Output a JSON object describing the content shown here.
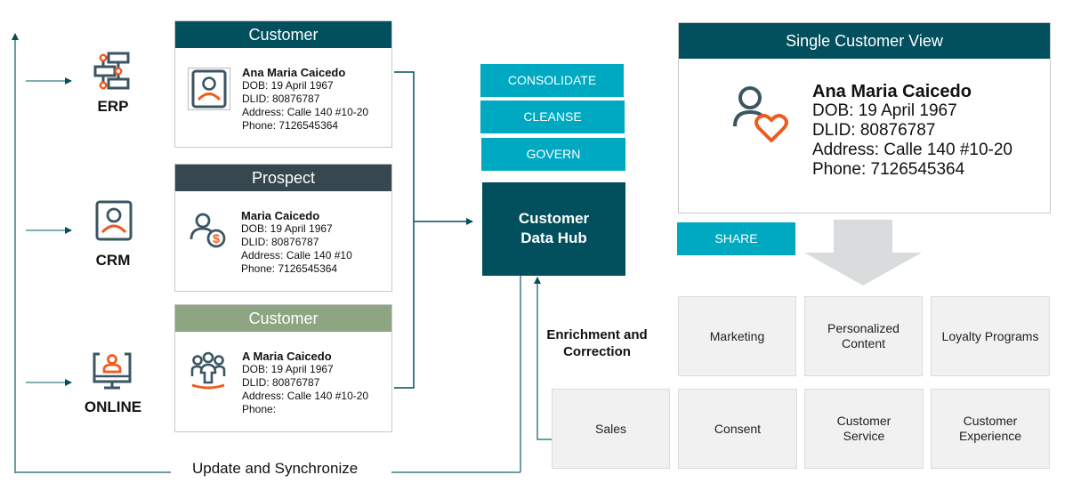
{
  "colors": {
    "dark_teal": "#024f5e",
    "slate": "#37474f",
    "sage": "#8da582",
    "cyan": "#00a9c2",
    "orange": "#f25a1d",
    "tile_gray": "#f1f1f1",
    "arrow_gray": "#d8dcdd"
  },
  "sources": [
    {
      "label": "ERP",
      "icon": "org-chart-icon"
    },
    {
      "label": "CRM",
      "icon": "contact-card-icon"
    },
    {
      "label": "ONLINE",
      "icon": "monitor-user-icon"
    }
  ],
  "records": [
    {
      "header": "Customer",
      "header_color": "#024f5e",
      "icon": "contact-card-icon",
      "name": "Ana Maria Caicedo",
      "dob": "DOB: 19 April 1967",
      "dlid": "DLID: 80876787",
      "address": "Address: Calle 140 #10-20",
      "phone": "Phone: 7126545364"
    },
    {
      "header": "Prospect",
      "header_color": "#37474f",
      "icon": "user-dollar-icon",
      "name": "Maria Caicedo",
      "dob": "DOB: 19 April 1967",
      "dlid": "DLID: 80876787",
      "address": "Address: Calle 140 #10",
      "phone": "Phone: 7126545364"
    },
    {
      "header": "Customer",
      "header_color": "#8da582",
      "icon": "user-group-icon",
      "name": "A Maria Caicedo",
      "dob": "DOB: 19 April 1967",
      "dlid": "DLID: 80876787",
      "address": "Address: Calle 140 #10-20",
      "phone": "Phone:"
    }
  ],
  "processes": [
    "CONSOLIDATE",
    "CLEANSE",
    "GOVERN"
  ],
  "hub": {
    "line1": "Customer",
    "line2": "Data Hub"
  },
  "single_view": {
    "title": "Single Customer View",
    "icon": "user-heart-icon",
    "name": "Ana Maria Caicedo",
    "dob": "DOB: 19 April 1967",
    "dlid": "DLID: 80876787",
    "address": "Address: Calle 140 #10-20",
    "phone": "Phone: 7126545364"
  },
  "share_label": "SHARE",
  "enrichment": {
    "line1": "Enrichment and",
    "line2": "Correction"
  },
  "sync_label": "Update and Synchronize",
  "use_cases": {
    "row1": [
      {
        "line1": "Marketing",
        "line2": ""
      },
      {
        "line1": "Personalized",
        "line2": "Content"
      },
      {
        "line1": "Loyalty Programs",
        "line2": ""
      }
    ],
    "row2": [
      {
        "line1": "Sales",
        "line2": ""
      },
      {
        "line1": "Consent",
        "line2": ""
      },
      {
        "line1": "Customer",
        "line2": "Service"
      },
      {
        "line1": "Customer",
        "line2": "Experience"
      }
    ]
  }
}
